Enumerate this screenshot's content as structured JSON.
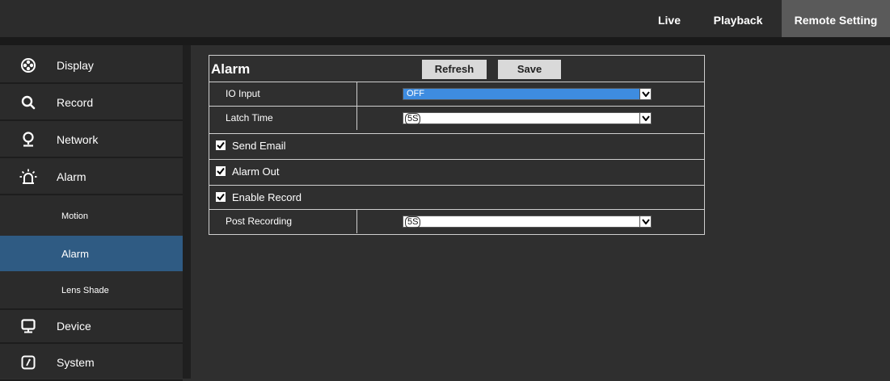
{
  "nav": {
    "items": [
      {
        "label": "Live"
      },
      {
        "label": "Playback"
      },
      {
        "label": "Remote Setting",
        "active": true
      }
    ]
  },
  "sidebar": {
    "items": [
      {
        "label": "Display",
        "icon": "aperture-icon"
      },
      {
        "label": "Record",
        "icon": "search-icon"
      },
      {
        "label": "Network",
        "icon": "location-pin-icon"
      },
      {
        "label": "Alarm",
        "icon": "alarm-light-icon"
      },
      {
        "label": "Device",
        "icon": "monitor-icon"
      },
      {
        "label": "System",
        "icon": "system-icon"
      }
    ],
    "subitems": [
      {
        "label": "Motion"
      },
      {
        "label": "Alarm",
        "active": true
      },
      {
        "label": "Lens Shade"
      }
    ],
    "active_color": "#2f5b83"
  },
  "panel": {
    "title": "Alarm",
    "refresh_label": "Refresh",
    "save_label": "Save",
    "io_input": {
      "label": "IO Input",
      "value": "OFF"
    },
    "latch_time": {
      "label": "Latch Time",
      "value": "5S"
    },
    "send_email": {
      "label": "Send Email",
      "checked": true
    },
    "alarm_out": {
      "label": "Alarm Out",
      "checked": true
    },
    "enable_record": {
      "label": "Enable Record",
      "checked": true
    },
    "post_recording": {
      "label": "Post Recording",
      "value": "5S"
    }
  }
}
